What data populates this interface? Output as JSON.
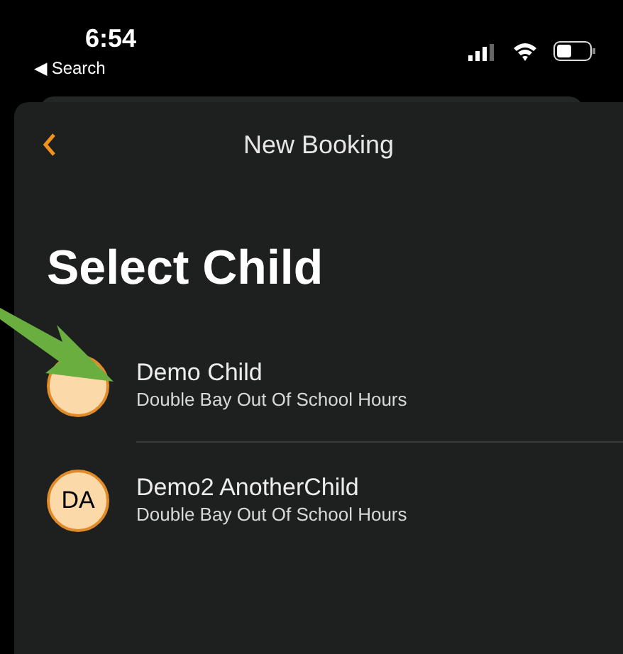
{
  "status_bar": {
    "time": "6:54",
    "back_label": "◀ Search"
  },
  "nav": {
    "title": "New Booking"
  },
  "heading": "Select Child",
  "children": [
    {
      "name": "Demo Child",
      "school": "Double Bay Out Of School Hours",
      "annotated": true
    },
    {
      "initials": "DA",
      "name": "Demo2 AnotherChild",
      "school": "Double Bay Out Of School Hours",
      "annotated": false
    }
  ]
}
